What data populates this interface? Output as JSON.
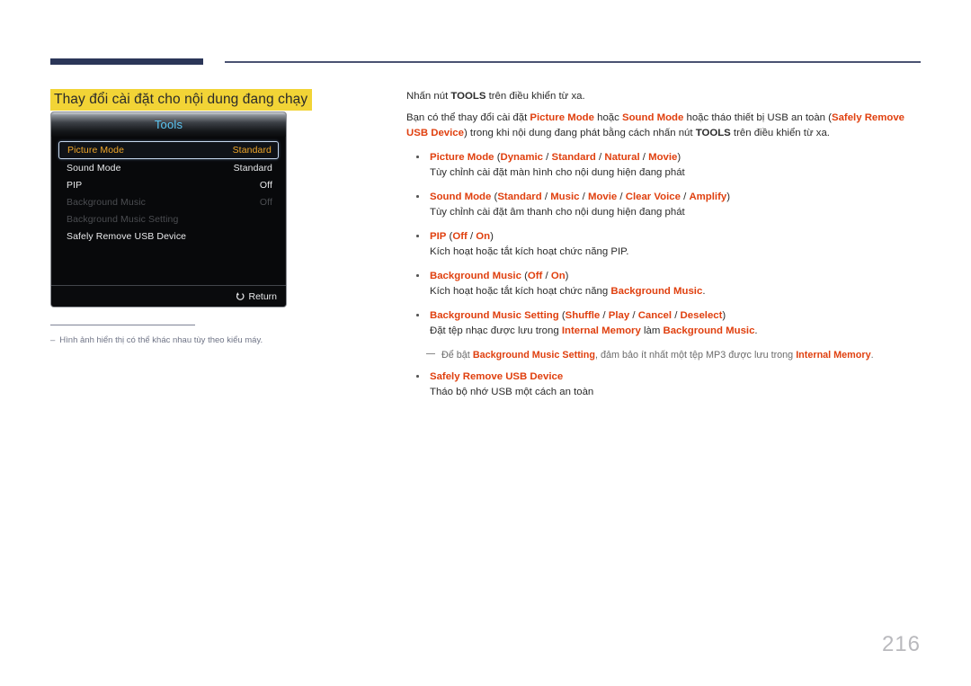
{
  "header": {
    "rule_color": "#2b3658"
  },
  "section": {
    "title": "Thay đổi cài đặt cho nội dung đang chạy",
    "highlight_color": "#f2d436"
  },
  "osd": {
    "title": "Tools",
    "title_color": "#5cc8f5",
    "selected_color": "#f0a72a",
    "rows": [
      {
        "label": "Picture Mode",
        "value": "Standard",
        "state": "selected"
      },
      {
        "label": "Sound Mode",
        "value": "Standard",
        "state": "normal"
      },
      {
        "label": "PIP",
        "value": "Off",
        "state": "normal"
      },
      {
        "label": "Background Music",
        "value": "Off",
        "state": "disabled"
      },
      {
        "label": "Background Music Setting",
        "value": "",
        "state": "disabled"
      },
      {
        "label": "Safely Remove USB Device",
        "value": "",
        "state": "normal"
      }
    ],
    "footer": {
      "return_label": "Return",
      "return_icon": "return-arrow-icon"
    }
  },
  "footnote": {
    "dash": "–",
    "text": "Hình ảnh hiển thị có thể khác nhau tùy theo kiểu máy."
  },
  "content": {
    "accent_color": "#e0400f",
    "p1": {
      "a": "Nhấn nút ",
      "b": "TOOLS",
      "c": " trên điều khiển từ xa."
    },
    "p2": {
      "a": "Bạn có thể thay đổi cài đặt ",
      "picture_mode": "Picture Mode",
      "b": " hoặc ",
      "sound_mode": "Sound Mode",
      "c": " hoặc tháo thiết bị USB an toàn (",
      "safely_remove": "Safely Remove USB Device",
      "d": ") trong khi nội dung đang phát bằng cách nhấn nút ",
      "tools": "TOOLS",
      "e": " trên điều khiển từ xa."
    },
    "bullets": [
      {
        "name": "Picture Mode",
        "open": " (",
        "options": [
          "Dynamic",
          "Standard",
          "Natural",
          "Movie"
        ],
        "close": ")",
        "desc": "Tùy chỉnh cài đặt màn hình cho nội dung hiện đang phát"
      },
      {
        "name": "Sound Mode",
        "open": " (",
        "options": [
          "Standard",
          "Music",
          "Movie",
          "Clear Voice",
          "Amplify"
        ],
        "close": ")",
        "desc": "Tùy chỉnh cài đặt âm thanh cho nội dung hiện đang phát"
      },
      {
        "name": "PIP",
        "open": " (",
        "options": [
          "Off",
          "On"
        ],
        "close": ")",
        "desc": "Kích hoạt hoặc tắt kích hoạt chức năng PIP."
      },
      {
        "name": "Background Music",
        "open": " (",
        "options": [
          "Off",
          "On"
        ],
        "close": ")",
        "desc_a": "Kích hoạt hoặc tắt kích hoạt chức năng ",
        "desc_hl": "Background Music",
        "desc_b": "."
      },
      {
        "name": "Background Music Setting",
        "open": " (",
        "options": [
          "Shuffle",
          "Play",
          "Cancel",
          "Deselect"
        ],
        "close": ")",
        "desc_a": "Đặt tệp nhạc được lưu trong ",
        "desc_hl1": "Internal Memory",
        "desc_b": " làm ",
        "desc_hl2": "Background Music",
        "desc_c": "."
      },
      {
        "name": "Safely Remove USB Device",
        "desc": "Tháo bộ nhớ USB một cách an toàn"
      }
    ],
    "note": {
      "a": "Để bật ",
      "hl1": "Background Music Setting",
      "b": ", đảm bảo ít nhất một tệp MP3 được lưu trong ",
      "hl2": "Internal Memory",
      "c": "."
    }
  },
  "page_number": "216"
}
